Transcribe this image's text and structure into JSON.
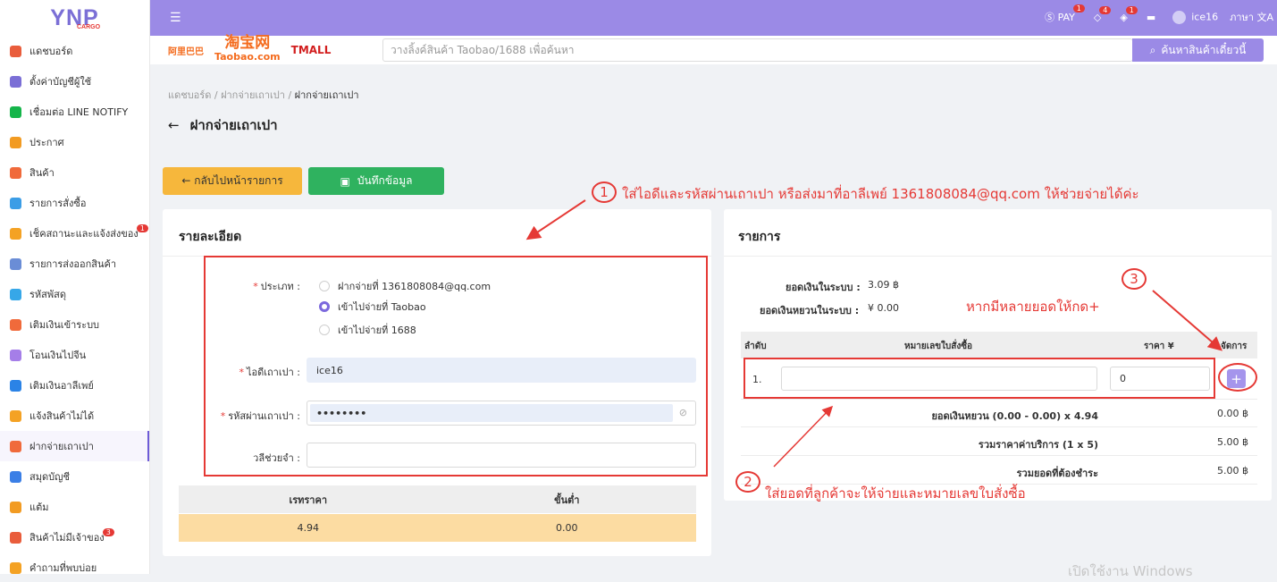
{
  "brand": {
    "name": "YNP",
    "sub": "CARGO"
  },
  "sidebar": {
    "items": [
      {
        "label": "แดชบอร์ด",
        "color": "#e95d3c"
      },
      {
        "label": "ตั้งค่าบัญชีผู้ใช้",
        "color": "#7b6fd6"
      },
      {
        "label": "เชื่อมต่อ LINE NOTIFY",
        "color": "#15b54a"
      },
      {
        "label": "ประกาศ",
        "color": "#f29b22"
      },
      {
        "label": "สินค้า",
        "color": "#f06a3b"
      },
      {
        "label": "รายการสั่งซื้อ",
        "color": "#3b9de6"
      },
      {
        "label": "เช็คสถานะและแจ้งส่งของ",
        "color": "#f4a224",
        "badge": "1"
      },
      {
        "label": "รายการส่งออกสินค้า",
        "color": "#6a8dd6"
      },
      {
        "label": "รหัสพัสดุ",
        "color": "#36a7e8"
      },
      {
        "label": "เติมเงินเข้าระบบ",
        "color": "#f06a3b"
      },
      {
        "label": "โอนเงินไปจีน",
        "color": "#a57ee8"
      },
      {
        "label": "เติมเงินอาลีเพย์",
        "color": "#2b83e6"
      },
      {
        "label": "แจ้งสินค้าไม่ได้",
        "color": "#f4a224"
      },
      {
        "label": "ฝากจ่ายเถาเปา",
        "color": "#f06a3b",
        "active": true
      },
      {
        "label": "สมุดบัญชี",
        "color": "#3b7fe6"
      },
      {
        "label": "แต้ม",
        "color": "#f29b22"
      },
      {
        "label": "สินค้าไม่มีเจ้าของ",
        "color": "#e95d3c",
        "badge": "3"
      },
      {
        "label": "คำถามที่พบบ่อย",
        "color": "#f4a224"
      }
    ]
  },
  "topbar": {
    "pay_label": "PAY",
    "pay_badge": "1",
    "tag_badge": "4",
    "box_badge": "1",
    "username": "ice16",
    "lang_label": "ภาษา"
  },
  "search": {
    "placeholder": "วางลิ้งค์สินค้า Taobao/1688 เพื่อค้นหา",
    "button_label": "ค้นหาสินค้าเดี๋ยวนี้",
    "logo1": "阿里巴巴",
    "logo2": "淘宝网",
    "logo2_sub": "Taobao.com",
    "logo3": "TMALL"
  },
  "breadcrumb": {
    "a": "แดชบอร์ด",
    "sep": "/",
    "b": "ฝากจ่ายเถาเปา",
    "c": "ฝากจ่ายเถาเปา"
  },
  "page": {
    "title": "ฝากจ่ายเถาเปา",
    "back_arrow": "←",
    "back_btn": "← กลับไปหน้ารายการ",
    "save_btn": "บันทึกข้อมูล"
  },
  "detail": {
    "title": "รายละเอียด",
    "type_label": "ประเภท :",
    "radios": [
      "ฝากจ่ายที่ 1361808084@qq.com",
      "เข้าไปจ่ายที่ Taobao",
      "เข้าไปจ่ายที่ 1688"
    ],
    "selected": 1,
    "id_label": "ไอดีเถาเปา :",
    "id_value": "ice16",
    "pw_label": "รหัสผ่านเถาเปา :",
    "pw_value": "••••••••",
    "remark_label": "วลีช่วยจำ :",
    "remark_value": "",
    "rate_head": [
      "เรทราคา",
      "ขั้นต่ำ"
    ],
    "rate_row": [
      "4.94",
      "0.00"
    ]
  },
  "items": {
    "title": "รายการ",
    "balance_label": "ยอดเงินในระบบ :",
    "balance_value": "3.09 ฿",
    "yuan_label": "ยอดเงินหยวนในระบบ :",
    "yuan_value": "¥ 0.00",
    "headers": [
      "ลำดับ",
      "หมายเลขใบสั่งซื้อ",
      "ราคา ¥",
      "จัดการ"
    ],
    "row_no": "1.",
    "order_value": "",
    "price_value": "0",
    "add_label": "+",
    "totals": [
      {
        "label": "ยอดเงินหยวน (0.00 - 0.00) x 4.94",
        "value": "0.00 ฿"
      },
      {
        "label": "รวมราคาค่าบริการ (1 x 5)",
        "value": "5.00 ฿"
      },
      {
        "label": "รวมยอดที่ต้องชำระ",
        "value": "5.00 ฿"
      }
    ]
  },
  "annotations": {
    "n1": "1",
    "t1": "ใส่ไอดีและรหัสผ่านเถาเปา หรือส่งมาที่อาลีเพย์ 1361808084@qq.com ให้ช่วยจ่ายได้ค่ะ",
    "n2": "2",
    "t2": "ใส่ยอดที่ลูกค้าจะให้จ่ายและหมายเลขใบสั่งซื้อ",
    "n3": "3",
    "t3": "หากมีหลายยอดให้กด+"
  },
  "watermark": "เปิดใช้งาน Windows"
}
